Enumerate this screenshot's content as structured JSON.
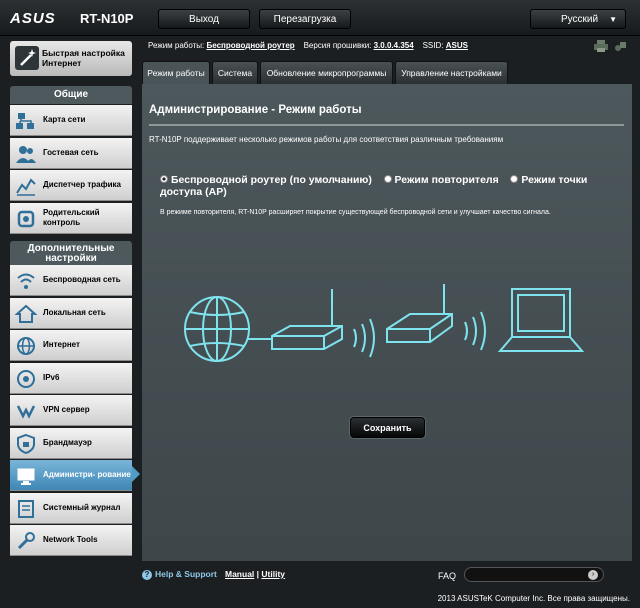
{
  "header": {
    "logo": "ASUS",
    "model": "RT-N10P",
    "logout_label": "Выход",
    "reboot_label": "Перезагрузка",
    "language": "Русский"
  },
  "sidebar": {
    "quick_setup": "Быстрая настройка Интернет",
    "general_title": "Общие",
    "general_items": [
      {
        "label": "Карта сети",
        "icon": "network-map-icon"
      },
      {
        "label": "Гостевая сеть",
        "icon": "guest-network-icon"
      },
      {
        "label": "Диспетчер трафика",
        "icon": "traffic-manager-icon"
      },
      {
        "label": "Родительский контроль",
        "icon": "parental-control-icon"
      }
    ],
    "advanced_title": "Дополнительные настройки",
    "advanced_items": [
      {
        "label": "Беспроводная сеть",
        "icon": "wireless-icon"
      },
      {
        "label": "Локальная сеть",
        "icon": "lan-icon"
      },
      {
        "label": "Интернет",
        "icon": "internet-icon"
      },
      {
        "label": "IPv6",
        "icon": "ipv6-icon"
      },
      {
        "label": "VPN сервер",
        "icon": "vpn-icon"
      },
      {
        "label": "Брандмауэр",
        "icon": "firewall-icon"
      },
      {
        "label": "Администри- рование",
        "icon": "administration-icon"
      },
      {
        "label": "Системный журнал",
        "icon": "system-log-icon"
      },
      {
        "label": "Network Tools",
        "icon": "network-tools-icon"
      }
    ]
  },
  "status": {
    "mode_label": "Режим работы:",
    "mode_value": "Беспроводной роутер",
    "firmware_label": "Версия прошивки:",
    "firmware_value": "3.0.0.4.354",
    "ssid_label": "SSID:",
    "ssid_value": "ASUS"
  },
  "tabs": [
    {
      "label": "Режим работы",
      "active": true
    },
    {
      "label": "Система",
      "active": false
    },
    {
      "label": "Обновление микропрограммы",
      "active": false
    },
    {
      "label": "Управление настройками",
      "active": false
    }
  ],
  "main": {
    "title": "Администрирование - Режим работы",
    "description": "RT-N10P поддерживает несколько режимов работы для соответствия различным требованиям",
    "options": [
      {
        "label": "Беспроводной роутер (по умолчанию)",
        "selected": true
      },
      {
        "label": "Режим повторителя",
        "selected": false
      },
      {
        "label": "Режим точки доступа (AP)",
        "selected": false
      }
    ],
    "note": "В режиме повторителя, RT-N10P расширяет покрытие существующей беспроводной сети и улучшает качество сигнала.",
    "save_label": "Сохранить"
  },
  "footer": {
    "help": "Help & Support",
    "manual": "Manual",
    "separator": "|",
    "utility": "Utility",
    "faq": "FAQ",
    "copyright": "2013 ASUSTeK Computer Inc. Все права защищены."
  },
  "colors": {
    "accent": "#4e9cc8",
    "menu_icon": "#2f6f98",
    "diagram_line": "#7fe3ee"
  }
}
